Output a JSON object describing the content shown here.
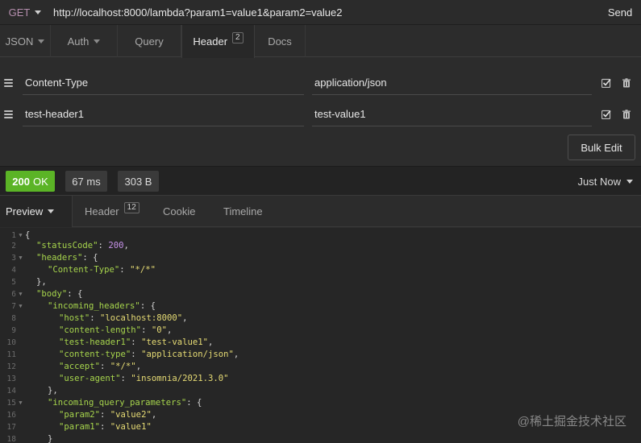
{
  "request": {
    "method": "GET",
    "url": "http://localhost:8000/lambda?param1=value1&param2=value2",
    "send_label": "Send"
  },
  "request_tabs": [
    {
      "label": "JSON",
      "has_caret": true
    },
    {
      "label": "Auth",
      "has_caret": true
    },
    {
      "label": "Query"
    },
    {
      "label": "Header",
      "badge": "2",
      "active": true
    },
    {
      "label": "Docs"
    }
  ],
  "headers": [
    {
      "name": "Content-Type",
      "value": "application/json",
      "enabled": true
    },
    {
      "name": "test-header1",
      "value": "test-value1",
      "enabled": true
    }
  ],
  "bulk_edit_label": "Bulk Edit",
  "response": {
    "status_code": "200",
    "status_text": "OK",
    "time": "67 ms",
    "size": "303 B",
    "history_label": "Just Now"
  },
  "response_tabs": [
    {
      "label": "Preview",
      "active": true,
      "has_caret": true
    },
    {
      "label": "Header",
      "badge": "12"
    },
    {
      "label": "Cookie"
    },
    {
      "label": "Timeline"
    }
  ],
  "body_lines": [
    {
      "n": "1",
      "fold": true,
      "indent": 0,
      "parts": [
        [
          "p",
          "{"
        ]
      ]
    },
    {
      "n": "2",
      "indent": 1,
      "parts": [
        [
          "k",
          "\"statusCode\""
        ],
        [
          "p",
          ": "
        ],
        [
          "n",
          "200"
        ],
        [
          "p",
          ","
        ]
      ]
    },
    {
      "n": "3",
      "fold": true,
      "indent": 1,
      "parts": [
        [
          "k",
          "\"headers\""
        ],
        [
          "p",
          ": {"
        ]
      ]
    },
    {
      "n": "4",
      "indent": 2,
      "parts": [
        [
          "k",
          "\"Content-Type\""
        ],
        [
          "p",
          ": "
        ],
        [
          "s",
          "\"*/*\""
        ]
      ]
    },
    {
      "n": "5",
      "indent": 1,
      "parts": [
        [
          "p",
          "},"
        ]
      ]
    },
    {
      "n": "6",
      "fold": true,
      "indent": 1,
      "parts": [
        [
          "k",
          "\"body\""
        ],
        [
          "p",
          ": {"
        ]
      ]
    },
    {
      "n": "7",
      "fold": true,
      "indent": 2,
      "parts": [
        [
          "k",
          "\"incoming_headers\""
        ],
        [
          "p",
          ": {"
        ]
      ]
    },
    {
      "n": "8",
      "indent": 3,
      "parts": [
        [
          "k",
          "\"host\""
        ],
        [
          "p",
          ": "
        ],
        [
          "s",
          "\"localhost:8000\""
        ],
        [
          "p",
          ","
        ]
      ]
    },
    {
      "n": "9",
      "indent": 3,
      "parts": [
        [
          "k",
          "\"content-length\""
        ],
        [
          "p",
          ": "
        ],
        [
          "s",
          "\"0\""
        ],
        [
          "p",
          ","
        ]
      ]
    },
    {
      "n": "10",
      "indent": 3,
      "parts": [
        [
          "k",
          "\"test-header1\""
        ],
        [
          "p",
          ": "
        ],
        [
          "s",
          "\"test-value1\""
        ],
        [
          "p",
          ","
        ]
      ]
    },
    {
      "n": "11",
      "indent": 3,
      "parts": [
        [
          "k",
          "\"content-type\""
        ],
        [
          "p",
          ": "
        ],
        [
          "s",
          "\"application/json\""
        ],
        [
          "p",
          ","
        ]
      ]
    },
    {
      "n": "12",
      "indent": 3,
      "parts": [
        [
          "k",
          "\"accept\""
        ],
        [
          "p",
          ": "
        ],
        [
          "s",
          "\"*/*\""
        ],
        [
          "p",
          ","
        ]
      ]
    },
    {
      "n": "13",
      "indent": 3,
      "parts": [
        [
          "k",
          "\"user-agent\""
        ],
        [
          "p",
          ": "
        ],
        [
          "s",
          "\"insomnia/2021.3.0\""
        ]
      ]
    },
    {
      "n": "14",
      "indent": 2,
      "parts": [
        [
          "p",
          "},"
        ]
      ]
    },
    {
      "n": "15",
      "fold": true,
      "indent": 2,
      "parts": [
        [
          "k",
          "\"incoming_query_parameters\""
        ],
        [
          "p",
          ": {"
        ]
      ]
    },
    {
      "n": "16",
      "indent": 3,
      "parts": [
        [
          "k",
          "\"param2\""
        ],
        [
          "p",
          ": "
        ],
        [
          "s",
          "\"value2\""
        ],
        [
          "p",
          ","
        ]
      ]
    },
    {
      "n": "17",
      "indent": 3,
      "parts": [
        [
          "k",
          "\"param1\""
        ],
        [
          "p",
          ": "
        ],
        [
          "s",
          "\"value1\""
        ]
      ]
    },
    {
      "n": "18",
      "indent": 2,
      "parts": [
        [
          "p",
          "}"
        ]
      ]
    }
  ],
  "watermark": "@稀土掘金技术社区",
  "colors": {
    "ok_green": "#5bb426",
    "method_purple": "#b48ead",
    "json_key": "#a6d44c",
    "json_string": "#e6db74",
    "json_number": "#c792ea"
  }
}
